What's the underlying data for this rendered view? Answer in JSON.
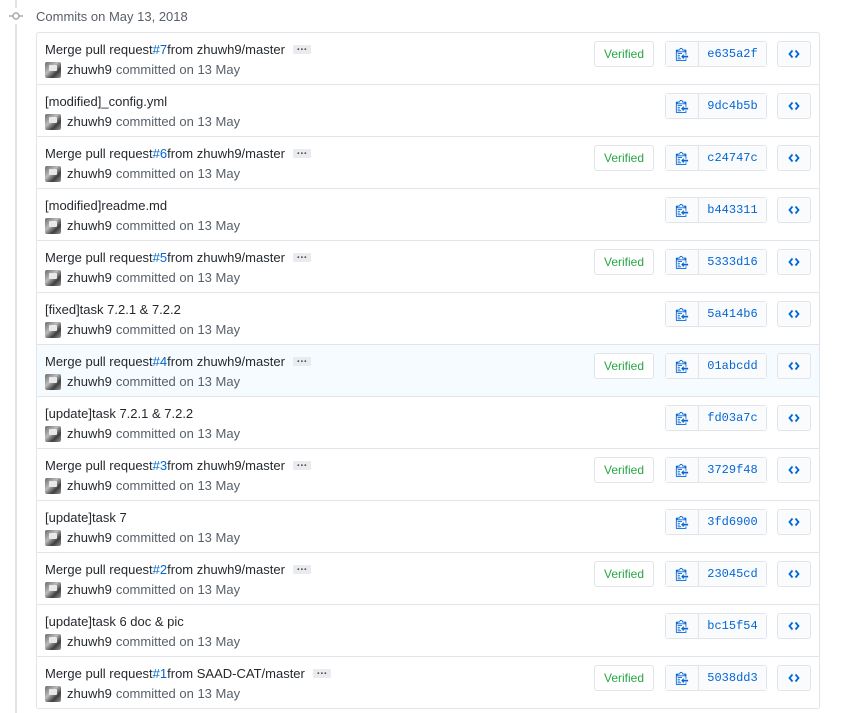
{
  "group": {
    "title": "Commits on May 13, 2018"
  },
  "commits": [
    {
      "msg_prefix": "Merge pull request ",
      "pr": "#7",
      "msg_suffix": " from zhuwh9/master",
      "has_ellipsis": true,
      "ellipsis": "…",
      "author": "zhuwh9",
      "meta": "committed on 13 May",
      "verified": "Verified",
      "sha": "e635a2f",
      "highlight": false
    },
    {
      "msg_prefix": "[modified]_config.yml",
      "pr": "",
      "msg_suffix": "",
      "has_ellipsis": false,
      "ellipsis": "",
      "author": "zhuwh9",
      "meta": "committed on 13 May",
      "verified": "",
      "sha": "9dc4b5b",
      "highlight": false
    },
    {
      "msg_prefix": "Merge pull request ",
      "pr": "#6",
      "msg_suffix": " from zhuwh9/master",
      "has_ellipsis": true,
      "ellipsis": "…",
      "author": "zhuwh9",
      "meta": "committed on 13 May",
      "verified": "Verified",
      "sha": "c24747c",
      "highlight": false
    },
    {
      "msg_prefix": "[modified]readme.md",
      "pr": "",
      "msg_suffix": "",
      "has_ellipsis": false,
      "ellipsis": "",
      "author": "zhuwh9",
      "meta": "committed on 13 May",
      "verified": "",
      "sha": "b443311",
      "highlight": false
    },
    {
      "msg_prefix": "Merge pull request ",
      "pr": "#5",
      "msg_suffix": " from zhuwh9/master",
      "has_ellipsis": true,
      "ellipsis": "…",
      "author": "zhuwh9",
      "meta": "committed on 13 May",
      "verified": "Verified",
      "sha": "5333d16",
      "highlight": false
    },
    {
      "msg_prefix": "[fixed]task 7.2.1 & 7.2.2",
      "pr": "",
      "msg_suffix": "",
      "has_ellipsis": false,
      "ellipsis": "",
      "author": "zhuwh9",
      "meta": "committed on 13 May",
      "verified": "",
      "sha": "5a414b6",
      "highlight": false
    },
    {
      "msg_prefix": "Merge pull request ",
      "pr": "#4",
      "msg_suffix": " from zhuwh9/master",
      "has_ellipsis": true,
      "ellipsis": "…",
      "author": "zhuwh9",
      "meta": "committed on 13 May",
      "verified": "Verified",
      "sha": "01abcdd",
      "highlight": true
    },
    {
      "msg_prefix": "[update]task 7.2.1 & 7.2.2",
      "pr": "",
      "msg_suffix": "",
      "has_ellipsis": false,
      "ellipsis": "",
      "author": "zhuwh9",
      "meta": "committed on 13 May",
      "verified": "",
      "sha": "fd03a7c",
      "highlight": false
    },
    {
      "msg_prefix": "Merge pull request ",
      "pr": "#3",
      "msg_suffix": " from zhuwh9/master",
      "has_ellipsis": true,
      "ellipsis": "…",
      "author": "zhuwh9",
      "meta": "committed on 13 May",
      "verified": "Verified",
      "sha": "3729f48",
      "highlight": false
    },
    {
      "msg_prefix": "[update]task 7",
      "pr": "",
      "msg_suffix": "",
      "has_ellipsis": false,
      "ellipsis": "",
      "author": "zhuwh9",
      "meta": "committed on 13 May",
      "verified": "",
      "sha": "3fd6900",
      "highlight": false
    },
    {
      "msg_prefix": "Merge pull request ",
      "pr": "#2",
      "msg_suffix": " from zhuwh9/master",
      "has_ellipsis": true,
      "ellipsis": "…",
      "author": "zhuwh9",
      "meta": "committed on 13 May",
      "verified": "Verified",
      "sha": "23045cd",
      "highlight": false
    },
    {
      "msg_prefix": "[update]task 6 doc & pic",
      "pr": "",
      "msg_suffix": "",
      "has_ellipsis": false,
      "ellipsis": "",
      "author": "zhuwh9",
      "meta": "committed on 13 May",
      "verified": "",
      "sha": "bc15f54",
      "highlight": false
    },
    {
      "msg_prefix": "Merge pull request ",
      "pr": "#1",
      "msg_suffix": " from SAAD-CAT/master",
      "has_ellipsis": true,
      "ellipsis": "…",
      "author": "zhuwh9",
      "meta": "committed on 13 May",
      "verified": "Verified",
      "sha": "5038dd3",
      "highlight": false
    }
  ],
  "icons": {
    "commit": "git-commit-icon",
    "copy": "clipboard-icon",
    "browse": "code-icon"
  },
  "colors": {
    "link": "#0366d6",
    "verified": "#28a745",
    "border": "#e1e4e8",
    "highlight": "#f6fbff"
  }
}
